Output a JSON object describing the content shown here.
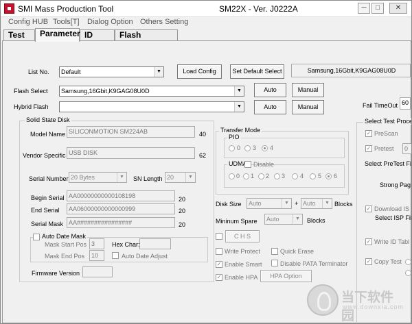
{
  "window": {
    "title": "SMI Mass Production Tool",
    "center_title": "SM22X - Ver. J0222A",
    "min_glyph": "─",
    "max_glyph": "□",
    "close_glyph": "✕"
  },
  "menu": [
    "Config HUB",
    "Tools[T]",
    "Dialog Option",
    "Others Setting"
  ],
  "tabs": [
    "Test",
    "Parameter",
    "ID Table",
    "Flash Diagnosis"
  ],
  "list_no": {
    "label": "List No.",
    "value": "Default",
    "load_config": "Load Config",
    "set_default": "Set Default Select",
    "info": "Samsung,16Gbit,K9GAG08U0D"
  },
  "flash_select": {
    "label": "Flash Select",
    "value": "Samsung,16Gbit,K9GAG08U0D",
    "auto": "Auto",
    "manual": "Manual"
  },
  "hybrid_flash": {
    "label": "Hybrid Flash",
    "value": "",
    "auto": "Auto",
    "manual": "Manual"
  },
  "fail_timeout": {
    "label": "Fail TimeOut",
    "value": "60"
  },
  "ssd": {
    "title": "Solid State Disk",
    "model_name_label": "Model Name",
    "model_name": "SILICONMOTION SM224AB",
    "model_len": "40",
    "vendor_label": "Vendor Specific",
    "vendor": "USB DISK",
    "vendor_len": "62",
    "serial_number_label": "Serial Number",
    "serial_number": "20 Bytes",
    "sn_length_label": "SN Length",
    "sn_length": "20",
    "begin_serial_label": "Begin Serial",
    "begin_serial": "AA00000000000108198",
    "begin_len": "20",
    "end_serial_label": "End Serial",
    "end_serial": "AA06000000000000999",
    "end_len": "20",
    "serial_mask_label": "Serial Mask",
    "serial_mask": "AA################",
    "mask_len": "20",
    "auto_date_mask": "Auto Date Mask",
    "mask_start_label": "Mask Start Pos",
    "mask_start": "3",
    "hex_char_label": "Hex Char:",
    "mask_end_label": "Mask End Pos",
    "mask_end": "10",
    "auto_date_adjust": "Auto Date Adjust",
    "firmware_label": "Firmware Version"
  },
  "transfer": {
    "title": "Transfer Mode",
    "pio": "PIO",
    "pio_options": [
      "0",
      "3",
      "4"
    ],
    "udma": "UDMA",
    "disable": "Disable",
    "udma_options": [
      "0",
      "1",
      "2",
      "3",
      "4",
      "5",
      "6"
    ]
  },
  "disk": {
    "size_label": "Disk Size",
    "size_value": "Auto",
    "plus": "+",
    "size_value2": "Auto",
    "blocks": "Blocks",
    "spare_label": "Mininum Spare",
    "spare_value": "Auto",
    "spare_blocks": "Blocks"
  },
  "options": {
    "chs": "C H S",
    "write_protect": "Write Protect",
    "quick_erase": "Quick Erase",
    "enable_smart": "Enable Smart",
    "disable_pata": "Disable PATA Terminator",
    "enable_hpa": "Enable HPA",
    "hpa_option": "HPA Option"
  },
  "test_proc": {
    "title": "Select Test Proce",
    "prescan": "PreScan",
    "pretest": "Pretest",
    "pretest_val": "0",
    "select_pretest": "Select PreTest Fi",
    "strong_page": "Strong Pag",
    "download_isp": "Download IS",
    "select_isp": "Select ISP Fil",
    "write_id": "Write ID Tabl",
    "copy_test": "Copy Test"
  },
  "watermark": {
    "text": "当下软件园",
    "sub": "www.downxia.com"
  }
}
